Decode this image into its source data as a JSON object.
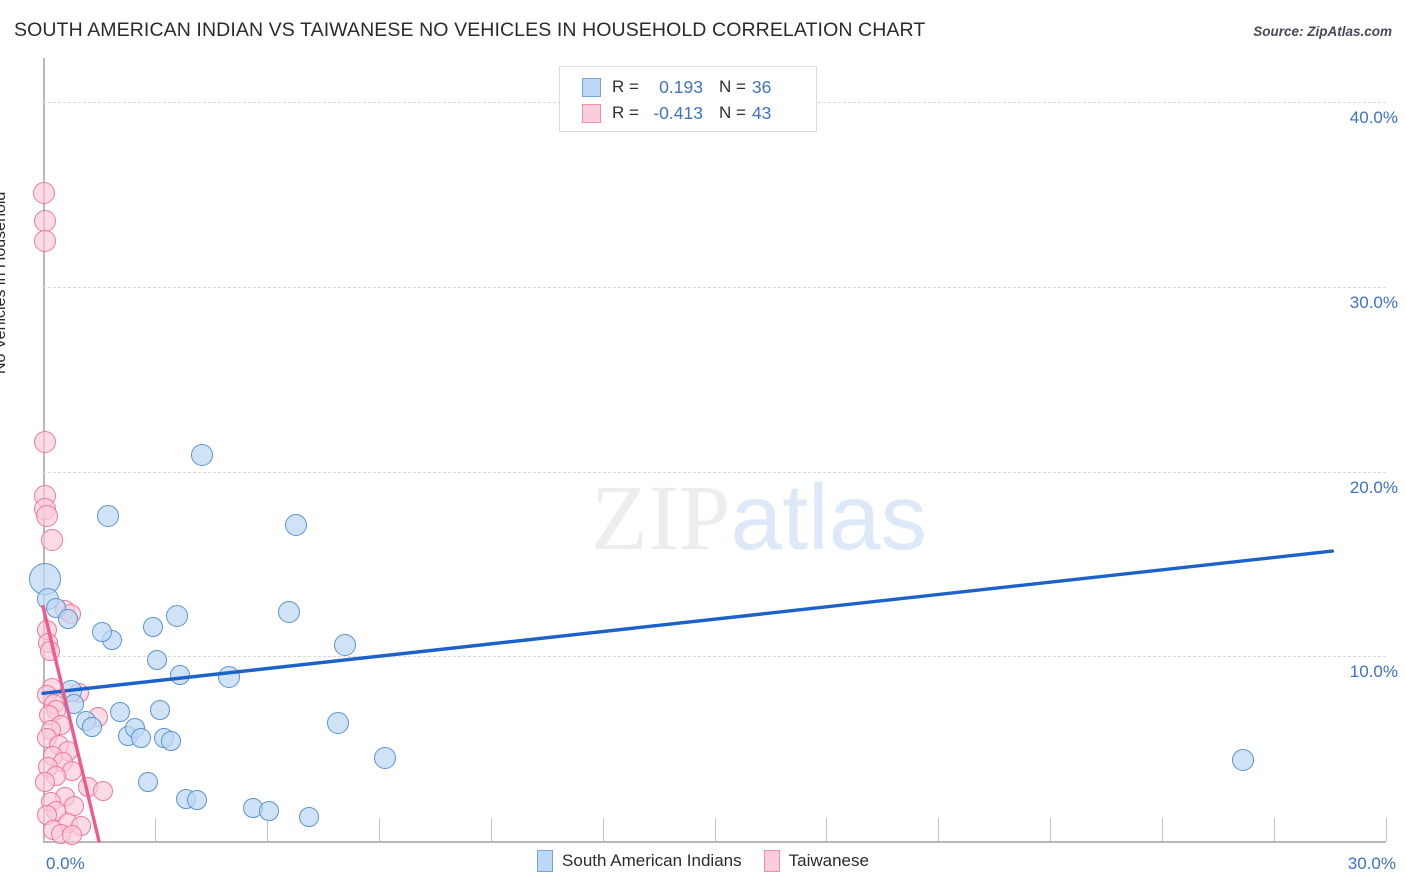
{
  "header": {
    "title": "SOUTH AMERICAN INDIAN VS TAIWANESE NO VEHICLES IN HOUSEHOLD CORRELATION CHART",
    "source": "Source: ZipAtlas.com"
  },
  "watermark": {
    "part1": "ZIP",
    "part2": "atlas"
  },
  "stats": {
    "blue": {
      "r_label": "R =",
      "r_value": "0.193",
      "n_label": "N =",
      "n_value": "36"
    },
    "pink": {
      "r_label": "R =",
      "r_value": "-0.413",
      "n_label": "N =",
      "n_value": "43"
    }
  },
  "legend": {
    "series": [
      {
        "name": "South American Indians",
        "color": "#bcd8f5"
      },
      {
        "name": "Taiwanese",
        "color": "#fbccda"
      }
    ]
  },
  "axes": {
    "y_title": "No Vehicles in Household",
    "y_ticks": [
      "40.0%",
      "30.0%",
      "20.0%",
      "10.0%"
    ],
    "x_min_label": "0.0%",
    "x_max_label": "30.0%"
  },
  "chart_data": {
    "type": "scatter",
    "title": "SOUTH AMERICAN INDIAN VS TAIWANESE NO VEHICLES IN HOUSEHOLD CORRELATION CHART",
    "xlabel": "",
    "ylabel": "No Vehicles in Household",
    "xlim": [
      0,
      30
    ],
    "ylim": [
      0,
      42.4
    ],
    "x_unit": "%",
    "y_unit": "%",
    "grid": true,
    "x_ticks": [
      0,
      2.5,
      5,
      7.5,
      10,
      12.5,
      15,
      17.5,
      20,
      22.5,
      25,
      27.5,
      30
    ],
    "y_ticks": [
      10,
      20,
      30,
      40
    ],
    "legend_position": "bottom-center",
    "series": [
      {
        "name": "South American Indians",
        "color": "#bcd8f5",
        "edge_color": "#5b94d6",
        "r": 0.193,
        "n": 36,
        "trendline": {
          "x0": 0.0,
          "y0": 8.0,
          "x1": 28.8,
          "y1": 15.7
        },
        "points": [
          {
            "x": 0.05,
            "y": 14.2,
            "r": 16
          },
          {
            "x": 0.12,
            "y": 13.1,
            "r": 11
          },
          {
            "x": 0.3,
            "y": 12.6,
            "r": 10
          },
          {
            "x": 0.55,
            "y": 12.0,
            "r": 10
          },
          {
            "x": 0.62,
            "y": 8.1,
            "r": 11
          },
          {
            "x": 0.7,
            "y": 7.4,
            "r": 10
          },
          {
            "x": 0.95,
            "y": 6.5,
            "r": 10
          },
          {
            "x": 1.1,
            "y": 6.2,
            "r": 10
          },
          {
            "x": 1.45,
            "y": 17.6,
            "r": 11
          },
          {
            "x": 1.55,
            "y": 10.9,
            "r": 10
          },
          {
            "x": 1.72,
            "y": 7.0,
            "r": 10
          },
          {
            "x": 1.9,
            "y": 5.7,
            "r": 10
          },
          {
            "x": 2.05,
            "y": 6.1,
            "r": 10
          },
          {
            "x": 2.2,
            "y": 5.6,
            "r": 10
          },
          {
            "x": 2.35,
            "y": 3.2,
            "r": 10
          },
          {
            "x": 2.55,
            "y": 9.8,
            "r": 10
          },
          {
            "x": 2.62,
            "y": 7.1,
            "r": 10
          },
          {
            "x": 2.7,
            "y": 5.6,
            "r": 10
          },
          {
            "x": 2.85,
            "y": 5.4,
            "r": 10
          },
          {
            "x": 3.0,
            "y": 12.2,
            "r": 11
          },
          {
            "x": 3.05,
            "y": 9.0,
            "r": 10
          },
          {
            "x": 3.2,
            "y": 2.3,
            "r": 10
          },
          {
            "x": 3.45,
            "y": 2.2,
            "r": 10
          },
          {
            "x": 3.55,
            "y": 20.9,
            "r": 11
          },
          {
            "x": 4.15,
            "y": 8.9,
            "r": 11
          },
          {
            "x": 4.7,
            "y": 1.8,
            "r": 10
          },
          {
            "x": 5.05,
            "y": 1.6,
            "r": 10
          },
          {
            "x": 5.95,
            "y": 1.3,
            "r": 10
          },
          {
            "x": 5.65,
            "y": 17.1,
            "r": 11
          },
          {
            "x": 5.5,
            "y": 12.4,
            "r": 11
          },
          {
            "x": 6.75,
            "y": 10.6,
            "r": 11
          },
          {
            "x": 6.6,
            "y": 6.4,
            "r": 11
          },
          {
            "x": 7.65,
            "y": 4.5,
            "r": 11
          },
          {
            "x": 1.32,
            "y": 11.3,
            "r": 10
          },
          {
            "x": 2.45,
            "y": 11.6,
            "r": 10
          },
          {
            "x": 26.8,
            "y": 4.4,
            "r": 11
          }
        ]
      },
      {
        "name": "Taiwanese",
        "color": "#fbccda",
        "edge_color": "#f0799f",
        "r": -0.413,
        "n": 43,
        "trendline": {
          "x0": 0.0,
          "y0": 12.7,
          "x1": 1.25,
          "y1": 0.0
        },
        "points": [
          {
            "x": 0.02,
            "y": 35.1,
            "r": 11
          },
          {
            "x": 0.04,
            "y": 33.6,
            "r": 11
          },
          {
            "x": 0.05,
            "y": 32.5,
            "r": 11
          },
          {
            "x": 0.05,
            "y": 21.6,
            "r": 11
          },
          {
            "x": 0.04,
            "y": 18.7,
            "r": 11
          },
          {
            "x": 0.05,
            "y": 18.0,
            "r": 11
          },
          {
            "x": 0.1,
            "y": 17.6,
            "r": 11
          },
          {
            "x": 0.2,
            "y": 16.3,
            "r": 11
          },
          {
            "x": 0.5,
            "y": 12.5,
            "r": 10
          },
          {
            "x": 0.62,
            "y": 12.3,
            "r": 10
          },
          {
            "x": 0.08,
            "y": 11.4,
            "r": 10
          },
          {
            "x": 0.12,
            "y": 10.7,
            "r": 10
          },
          {
            "x": 0.15,
            "y": 10.3,
            "r": 10
          },
          {
            "x": 0.8,
            "y": 8.0,
            "r": 10
          },
          {
            "x": 0.2,
            "y": 8.3,
            "r": 10
          },
          {
            "x": 0.1,
            "y": 7.9,
            "r": 10
          },
          {
            "x": 0.25,
            "y": 7.4,
            "r": 10
          },
          {
            "x": 0.3,
            "y": 7.1,
            "r": 10
          },
          {
            "x": 0.14,
            "y": 6.8,
            "r": 10
          },
          {
            "x": 1.22,
            "y": 6.7,
            "r": 10
          },
          {
            "x": 0.4,
            "y": 6.3,
            "r": 10
          },
          {
            "x": 0.18,
            "y": 6.0,
            "r": 10
          },
          {
            "x": 0.08,
            "y": 5.6,
            "r": 10
          },
          {
            "x": 0.35,
            "y": 5.2,
            "r": 10
          },
          {
            "x": 0.55,
            "y": 4.9,
            "r": 10
          },
          {
            "x": 0.22,
            "y": 4.6,
            "r": 10
          },
          {
            "x": 0.45,
            "y": 4.3,
            "r": 10
          },
          {
            "x": 0.12,
            "y": 4.0,
            "r": 10
          },
          {
            "x": 0.65,
            "y": 3.8,
            "r": 10
          },
          {
            "x": 0.3,
            "y": 3.5,
            "r": 10
          },
          {
            "x": 0.05,
            "y": 3.2,
            "r": 10
          },
          {
            "x": 1.0,
            "y": 2.9,
            "r": 10
          },
          {
            "x": 1.35,
            "y": 2.7,
            "r": 10
          },
          {
            "x": 0.5,
            "y": 2.4,
            "r": 10
          },
          {
            "x": 0.18,
            "y": 2.1,
            "r": 10
          },
          {
            "x": 0.7,
            "y": 1.9,
            "r": 10
          },
          {
            "x": 0.28,
            "y": 1.6,
            "r": 10
          },
          {
            "x": 0.08,
            "y": 1.4,
            "r": 10
          },
          {
            "x": 0.55,
            "y": 1.0,
            "r": 10
          },
          {
            "x": 0.85,
            "y": 0.8,
            "r": 10
          },
          {
            "x": 0.22,
            "y": 0.6,
            "r": 10
          },
          {
            "x": 0.4,
            "y": 0.4,
            "r": 10
          },
          {
            "x": 0.65,
            "y": 0.3,
            "r": 10
          }
        ]
      }
    ]
  }
}
